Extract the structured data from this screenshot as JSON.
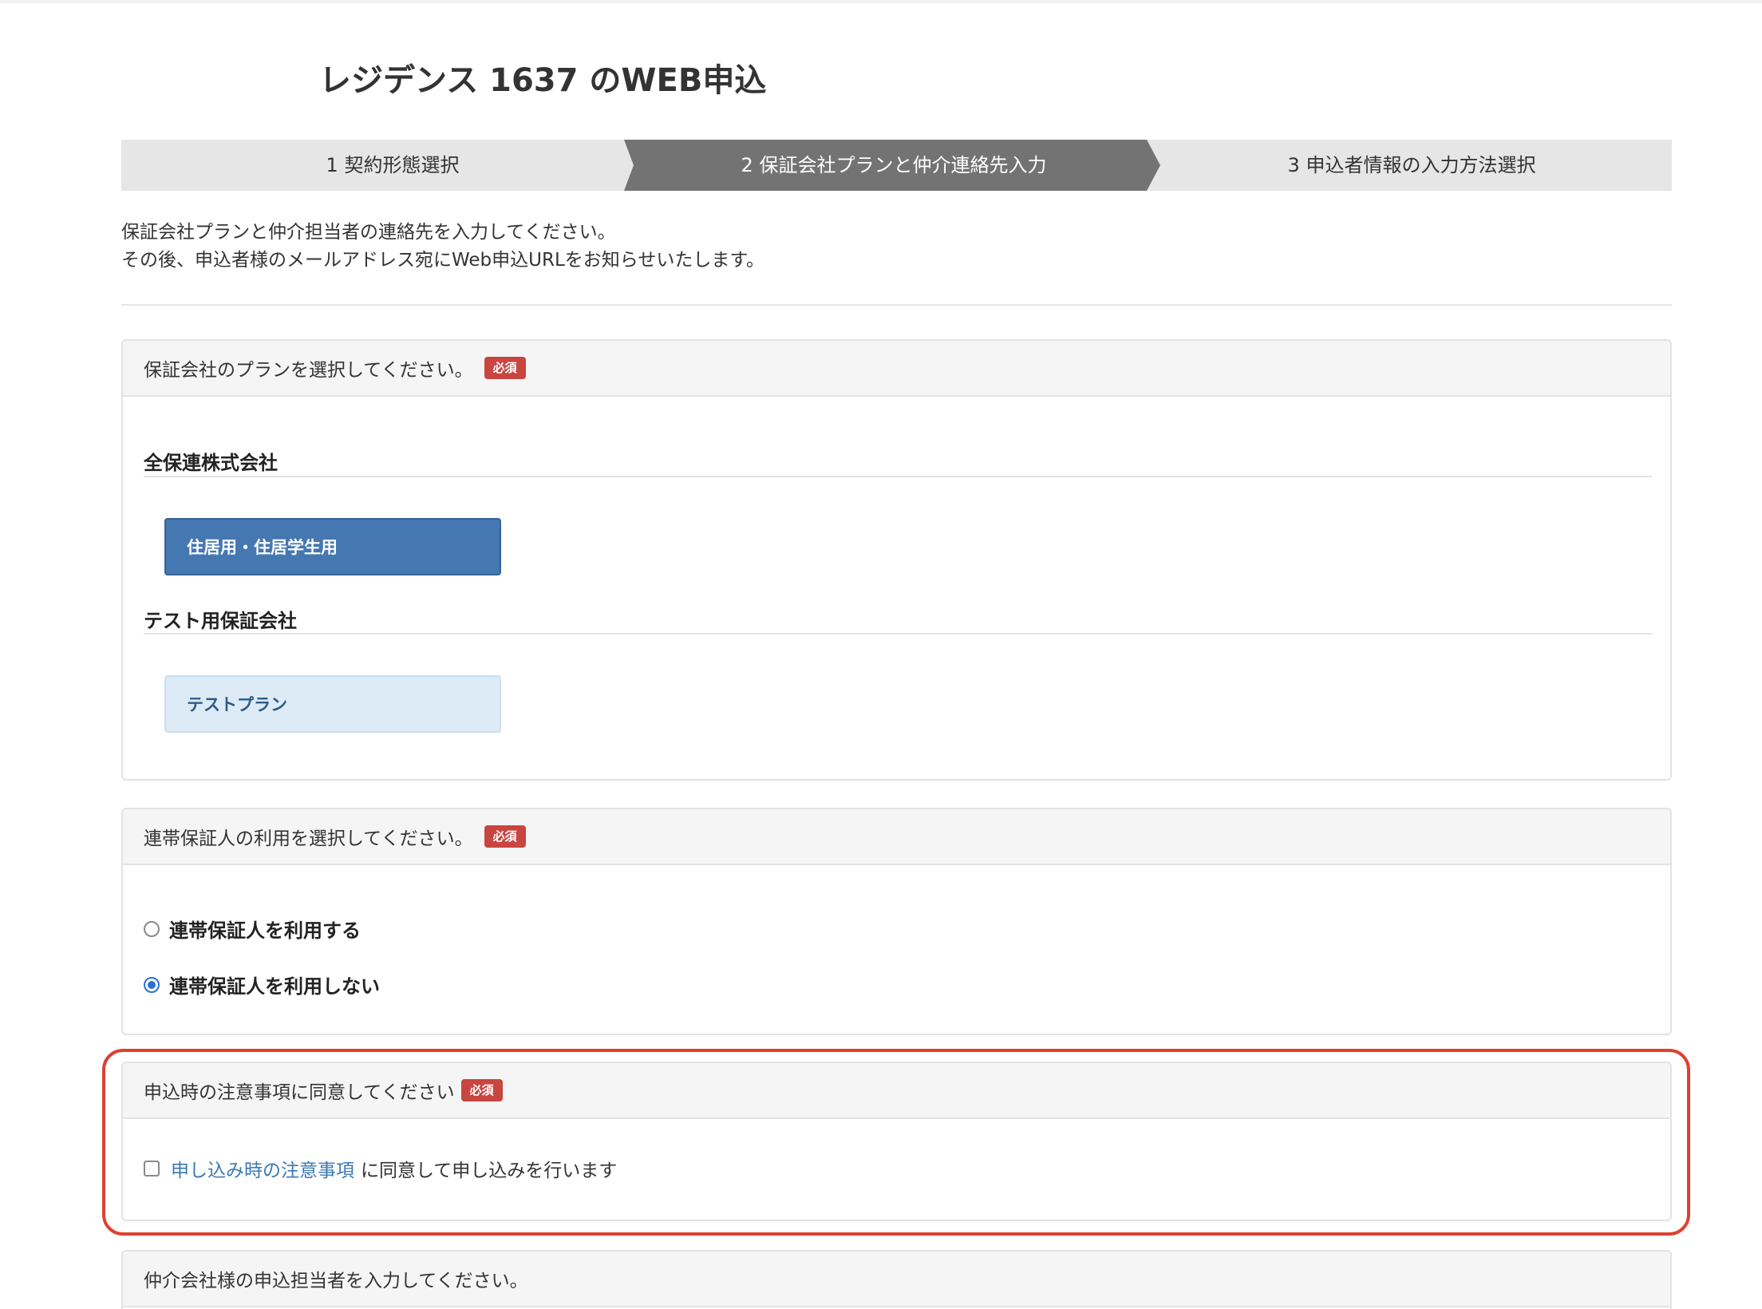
{
  "page": {
    "title": "レジデンス 1637 のWEB申込"
  },
  "steps": [
    {
      "label": "1 契約形態選択"
    },
    {
      "label": "2 保証会社プランと仲介連絡先入力"
    },
    {
      "label": "3 申込者情報の入力方法選択"
    }
  ],
  "intro": {
    "line1": "保証会社プランと仲介担当者の連絡先を入力してください。",
    "line2": "その後、申込者様のメールアドレス宛にWeb申込URLをお知らせいたします。"
  },
  "plan_section": {
    "heading": "保証会社のプランを選択してください。",
    "badge": "必須",
    "companies": [
      {
        "name": "全保連株式会社",
        "plans": [
          {
            "label": "住居用・住居学生用",
            "selected": true
          }
        ]
      },
      {
        "name": "テスト用保証会社",
        "plans": [
          {
            "label": "テストプラン",
            "selected": false
          }
        ]
      }
    ]
  },
  "guarantor_section": {
    "heading": "連帯保証人の利用を選択してください。",
    "badge": "必須",
    "options": [
      {
        "label": "連帯保証人を利用する",
        "checked": false
      },
      {
        "label": "連帯保証人を利用しない",
        "checked": true
      }
    ]
  },
  "agreement_section": {
    "heading": "申込時の注意事項に同意してください",
    "badge": "必須",
    "link_text": "申し込み時の注意事項",
    "suffix_text": "に同意して申し込みを行います",
    "checked": false
  },
  "agent_section": {
    "heading": "仲介会社様の申込担当者を入力してください。"
  },
  "colors": {
    "required_badge": "#c9453f",
    "selected_plan": "#4577b1",
    "unselected_plan": "#dcebf6",
    "active_step": "#737373",
    "highlight_border": "#e0402f",
    "link": "#3a78b5"
  }
}
